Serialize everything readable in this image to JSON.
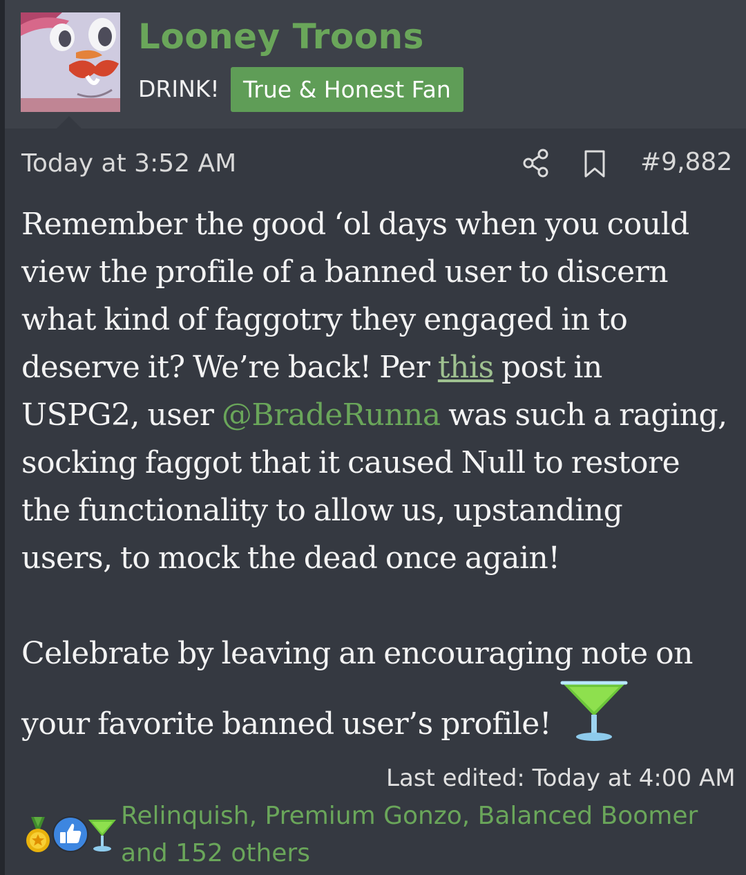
{
  "author": {
    "username": "Looney Troons",
    "user_title": "DRINK!",
    "badge": "True & Honest Fan",
    "avatar": "cartoon-character-avatar"
  },
  "post": {
    "date": "Today at 3:52 AM",
    "number": "#9,882",
    "icons": {
      "share": "share-icon",
      "bookmark": "bookmark-icon"
    },
    "body": {
      "line1": "Remember the good ‘ol days when you could",
      "line2": "view the profile of a banned user to discern",
      "line3": "what kind of faggotry they engaged in to",
      "line4_before": "deserve it? We’re back! Per ",
      "line4_link": "this",
      "line4_after": " post in",
      "line5_before": "USPG2, user ",
      "line5_mention": "@BradeRunna",
      "line5_after": " was such a raging,",
      "line6": "socking faggot that it caused Null to restore",
      "line7": "the functionality to allow us, upstanding",
      "line8": "users, to mock the dead once again!",
      "line9": "Celebrate by leaving an encouraging note on",
      "line10": "your favorite banned user’s profile!",
      "emoji": "cocktail-glass-emoji"
    },
    "last_edited": "Last edited: Today at 4:00 AM"
  },
  "reactions": {
    "icons": [
      "medal-icon",
      "thumbs-up-icon",
      "cocktail-icon"
    ],
    "line1": "Relinquish, Premium Gonzo, Balanced Boomer",
    "line2": "and 152 others"
  },
  "colors": {
    "page_background": "#2b2f36",
    "post_background": "#353941",
    "author_bar": "#3d4149",
    "accent_green": "#6aa65a",
    "badge_green": "#5f9d57",
    "link_green": "#9fc190"
  }
}
